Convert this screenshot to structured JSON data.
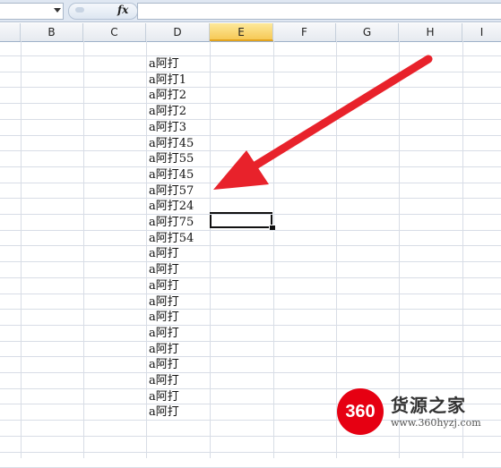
{
  "formula_bar": {
    "fx_label": "fx",
    "value": ""
  },
  "columns": [
    {
      "letter": "",
      "selected": false
    },
    {
      "letter": "B",
      "selected": false
    },
    {
      "letter": "C",
      "selected": false
    },
    {
      "letter": "D",
      "selected": false
    },
    {
      "letter": "E",
      "selected": true
    },
    {
      "letter": "F",
      "selected": false
    },
    {
      "letter": "G",
      "selected": false
    },
    {
      "letter": "H",
      "selected": false
    },
    {
      "letter": "I",
      "selected": false
    }
  ],
  "column_d_values": [
    "a阿打",
    "a阿打1",
    "a阿打2",
    "a阿打2",
    "a阿打3",
    "a阿打45",
    "a阿打55",
    "a阿打45",
    "a阿打57",
    "a阿打24",
    "a阿打75",
    "a阿打54",
    "a阿打",
    "a阿打",
    "a阿打",
    "a阿打",
    "a阿打",
    "a阿打",
    "a阿打",
    "a阿打",
    "a阿打",
    "a阿打",
    "a阿打"
  ],
  "annotation": {
    "arrow_color": "#e8222b"
  },
  "watermark": {
    "logo_text": "360",
    "title": "货源之家",
    "url": "www.360hyzj.com"
  }
}
